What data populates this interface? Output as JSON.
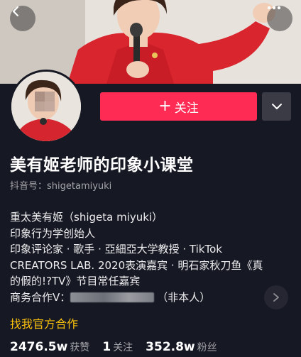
{
  "nav": {
    "back_icon": "chevron-left-icon",
    "more_icon": "more-horizontal-icon"
  },
  "profile": {
    "follow_label": "关注",
    "follow_icon": "plus-icon",
    "dropdown_icon": "chevron-down-icon",
    "username": "美有姬老师的印象小课堂",
    "douyin_id": "抖音号：shigetamiyuki",
    "bio_lines": [
      "重太美有姬（shigeta miyuki）",
      "印象行为学创始人",
      "印象评论家 · 歌手 · 亞細亞大学教授 · TikTok",
      "CREATORS LAB. 2020表演嘉宾 · 明石家秋刀鱼《真",
      "的假的!?TV》节目常任嘉宾"
    ],
    "business_prefix": "商务合作V：",
    "business_suffix": "（非本人）",
    "business_link": "找我官方合作",
    "expand_icon": "chevron-right-icon"
  },
  "stats": [
    {
      "value": "2476.5w",
      "label": "获赞"
    },
    {
      "value": "1",
      "label": "关注"
    },
    {
      "value": "352.8w",
      "label": "粉丝"
    }
  ],
  "colors": {
    "background": "#161823",
    "accent": "#fe2c55",
    "link": "#f9c10d"
  }
}
